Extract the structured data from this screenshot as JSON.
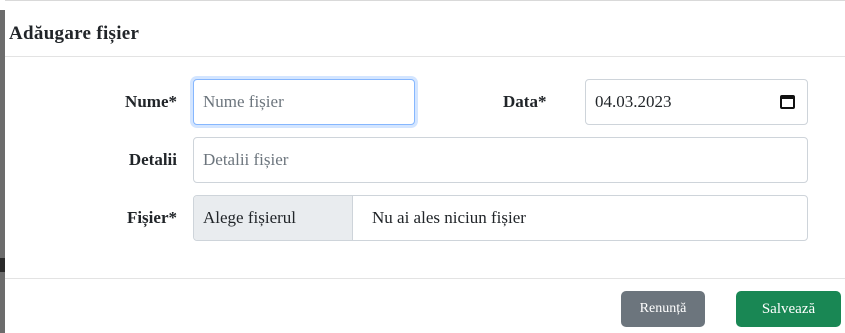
{
  "modal": {
    "title": "Adăugare fișier"
  },
  "form": {
    "nume": {
      "label": "Nume*",
      "placeholder": "Nume fișier",
      "value": ""
    },
    "data": {
      "label": "Data*",
      "value": "04.03.2023",
      "icon": "calendar-icon"
    },
    "detalii": {
      "label": "Detalii",
      "placeholder": "Detalii fișier",
      "value": ""
    },
    "fisier": {
      "label": "Fișier*",
      "button_label": "Alege fișierul",
      "status": "Nu ai ales niciun fișier"
    }
  },
  "footer": {
    "cancel_label": "Renunță",
    "save_label": "Salvează"
  },
  "colors": {
    "cancel": "#6c757d",
    "save": "#198754",
    "focus": "#86b7fe"
  }
}
